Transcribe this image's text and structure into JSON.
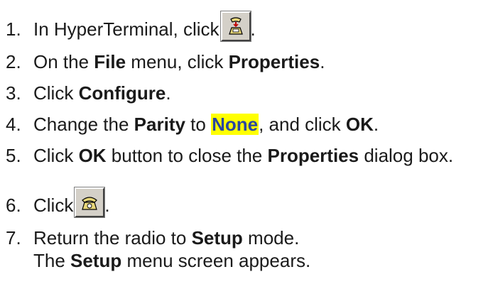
{
  "steps": [
    {
      "num": "1.",
      "pre": "In HyperTerminal, click",
      "post": ".",
      "icon": "disconnect-phone-icon"
    },
    {
      "num": "2.",
      "t1": "On the ",
      "b1": "File",
      "t2": " menu, click ",
      "b2": "Properties",
      "t3": "."
    },
    {
      "num": "3.",
      "t1": "Click ",
      "b1": "Configure",
      "t2": "."
    },
    {
      "num": "4.",
      "t1": "Change the ",
      "b1": "Parity",
      "t2": " to ",
      "hl": "None",
      "t3": ", and click ",
      "b2": "OK",
      "t4": "."
    },
    {
      "num": "5.",
      "t1": "Click ",
      "b1": "OK",
      "t2": " button to close the ",
      "b2": "Properties",
      "t3": " dialog box."
    },
    {
      "num": "6.",
      "pre": "Click",
      "post": ".",
      "icon": "connect-phone-icon"
    },
    {
      "num": "7.",
      "t1": "Return the radio to ",
      "b1": "Setup",
      "t2": " mode.",
      "c1": "The ",
      "cb": "Setup",
      "c2": " menu screen appears."
    }
  ],
  "colors": {
    "highlight_bg": "#ffff00",
    "highlight_text": "#2a46a0",
    "button_face": "#d4d0c8",
    "phone_yellow": "#e8d77a"
  }
}
